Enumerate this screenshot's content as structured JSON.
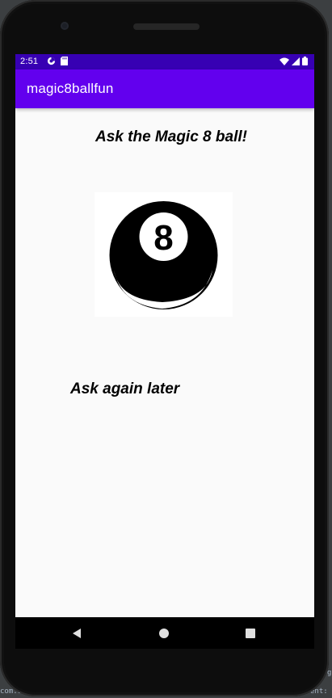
{
  "status_bar": {
    "time": "2:51",
    "background": "#3700b3",
    "left_icons": [
      "data-saver-icon",
      "sd-card-icon"
    ],
    "right_icons": [
      "wifi-icon",
      "cell-signal-icon",
      "battery-icon"
    ]
  },
  "app_bar": {
    "title": "magic8ballfun",
    "background": "#6200ee"
  },
  "main": {
    "heading": "Ask the Magic 8 ball!",
    "ball_image": {
      "icon": "magic-8-ball-icon",
      "label": "8"
    },
    "answer": "Ask again later",
    "background": "#fafafa"
  },
  "nav_bar": {
    "buttons": [
      "back-button",
      "home-button",
      "recents-button"
    ]
  },
  "ide_background": {
    "fragments": [
      "com.ex",
      "g",
      "ent:"
    ]
  }
}
